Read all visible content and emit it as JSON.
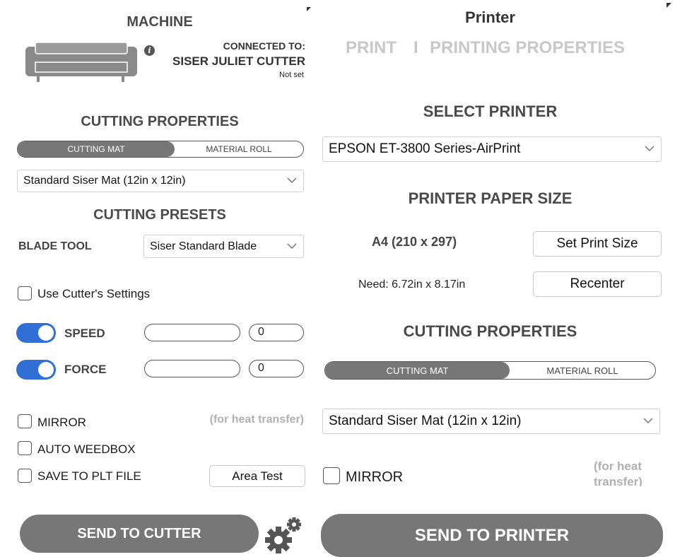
{
  "machine_panel": {
    "title": "MACHINE",
    "connected_label": "CONNECTED TO:",
    "device_name": "SISER JULIET CUTTER",
    "device_status": "Not set",
    "cutting_properties_title": "CUTTING PROPERTIES",
    "segment": {
      "active": "CUTTING MAT",
      "inactive": "MATERIAL ROLL"
    },
    "mat_select": "Standard Siser Mat (12in x 12in)",
    "cutting_presets_title": "CUTTING PRESETS",
    "blade_tool_label": "BLADE TOOL",
    "blade_tool_select": "Siser Standard Blade",
    "use_cutter_settings_label": "Use Cutter's Settings",
    "speed_label": "SPEED",
    "speed_value": "0",
    "force_label": "FORCE",
    "force_value": "0",
    "mirror_label": "MIRROR",
    "mirror_note": "(for heat transfer)",
    "auto_weedbox_label": "AUTO WEEDBOX",
    "save_plt_label": "SAVE TO PLT FILE",
    "area_test_label": "Area Test",
    "send_button": "SEND TO CUTTER"
  },
  "printer_panel": {
    "title": "Printer",
    "tabs": [
      "PRINT",
      "PRINTING PROPERTIES"
    ],
    "tab_separator": "I",
    "select_printer_title": "SELECT PRINTER",
    "printer_select": "EPSON ET-3800 Series-AirPrint",
    "paper_size_title": "PRINTER PAPER SIZE",
    "paper_size_value": "A4 (210 x 297)",
    "set_print_size_button": "Set Print Size",
    "need_text": "Need: 6.72in x 8.17in",
    "recenter_button": "Recenter",
    "cutting_properties_title": "CUTTING PROPERTIES",
    "segment": {
      "active": "CUTTING MAT",
      "inactive": "MATERIAL ROLL"
    },
    "mat_select": "Standard Siser Mat (12in x 12in)",
    "mirror_label": "MIRROR",
    "mirror_note_line1": "(for heat",
    "mirror_note_line2": "transfer)",
    "send_button": "SEND TO PRINTER"
  },
  "colors": {
    "toggle_on": "#2f6fd6",
    "button_gray": "#777777",
    "heading_gray": "#4a4a4a",
    "tab_gray": "#c8c8c8"
  },
  "icons": [
    "cutter-machine-icon",
    "info-icon",
    "chevron-down-icon",
    "gear-icon"
  ]
}
